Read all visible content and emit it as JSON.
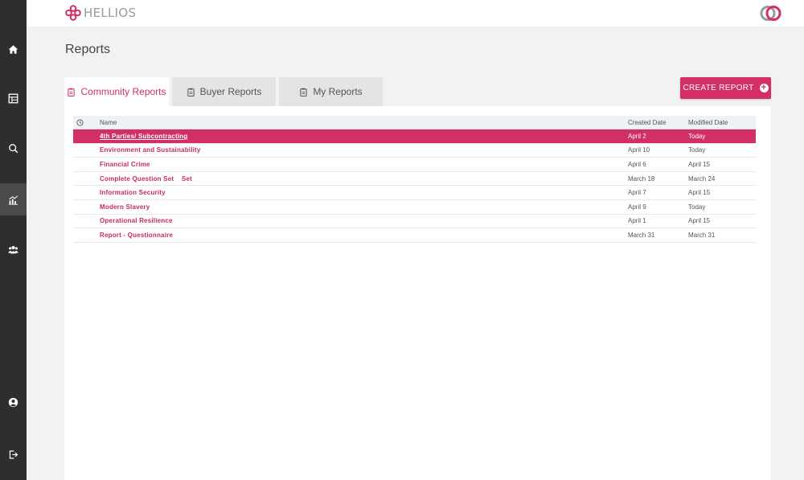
{
  "app": {
    "logo_text": "HELLIOS"
  },
  "sidebar": {
    "items": [
      {
        "icon": "home-icon"
      },
      {
        "icon": "dashboard-icon"
      },
      {
        "icon": "search-icon"
      },
      {
        "icon": "reports-chart-icon",
        "active": true
      },
      {
        "icon": "users-icon"
      },
      {
        "icon": "profile-icon"
      },
      {
        "icon": "logout-icon"
      }
    ]
  },
  "page": {
    "title": "Reports"
  },
  "tabs": [
    {
      "label": "Community Reports",
      "active": true
    },
    {
      "label": "Buyer Reports"
    },
    {
      "label": "My Reports"
    }
  ],
  "actions": {
    "create_label": "CREATE REPORT"
  },
  "table": {
    "headers": {
      "name": "Name",
      "created": "Created Date",
      "modified": "Modified Date"
    },
    "rows": [
      {
        "name": "4th Parties/ Subcontracting",
        "created": "April 2",
        "modified": "Today",
        "selected": true
      },
      {
        "name": "Environment and Sustainability",
        "created": "April 10",
        "modified": "Today"
      },
      {
        "name": "Financial Crime",
        "created": "April 6",
        "modified": "April 15"
      },
      {
        "name": "Complete Question Set    Set",
        "created": "March 18",
        "modified": "March 24"
      },
      {
        "name": "Information Security",
        "created": "April 7",
        "modified": "April 15"
      },
      {
        "name": "Modern Slavery",
        "created": "April 9",
        "modified": "Today"
      },
      {
        "name": "Operational Resilience",
        "created": "April 1",
        "modified": "April 15"
      },
      {
        "name": "Report - Questionnaire",
        "created": "March 31",
        "modified": "March 31"
      }
    ]
  },
  "colors": {
    "accent": "#d12f66",
    "sidebar": "#2e2e2e",
    "background": "#f2f2f2"
  }
}
